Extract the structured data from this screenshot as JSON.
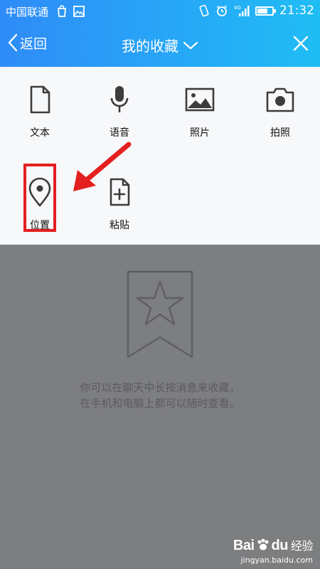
{
  "status_bar": {
    "carrier": "中国联通",
    "time": "21:32",
    "battery_level": 0.7,
    "signal_label": "4G"
  },
  "nav": {
    "back_label": "返回",
    "title": "我的收藏"
  },
  "actions": [
    {
      "label": "文本",
      "icon": "document-icon"
    },
    {
      "label": "语音",
      "icon": "microphone-icon"
    },
    {
      "label": "照片",
      "icon": "image-icon"
    },
    {
      "label": "拍照",
      "icon": "camera-icon"
    },
    {
      "label": "位置",
      "icon": "location-pin-icon"
    },
    {
      "label": "粘贴",
      "icon": "paste-add-icon"
    }
  ],
  "empty_state": {
    "icon": "bookmark-star-icon",
    "line1": "你可以在聊天中长按消息来收藏，",
    "line2": "在手机和电脑上都可以随时查看。"
  },
  "watermark": {
    "logo_left": "Bai",
    "logo_right": "du",
    "label": "经验",
    "url": "jingyan.baidu.com"
  },
  "colors": {
    "header_start": "#2f8cf7",
    "header_end": "#1fbdf4",
    "highlight": "#e41f1f",
    "overlay": "#7d7e80"
  }
}
